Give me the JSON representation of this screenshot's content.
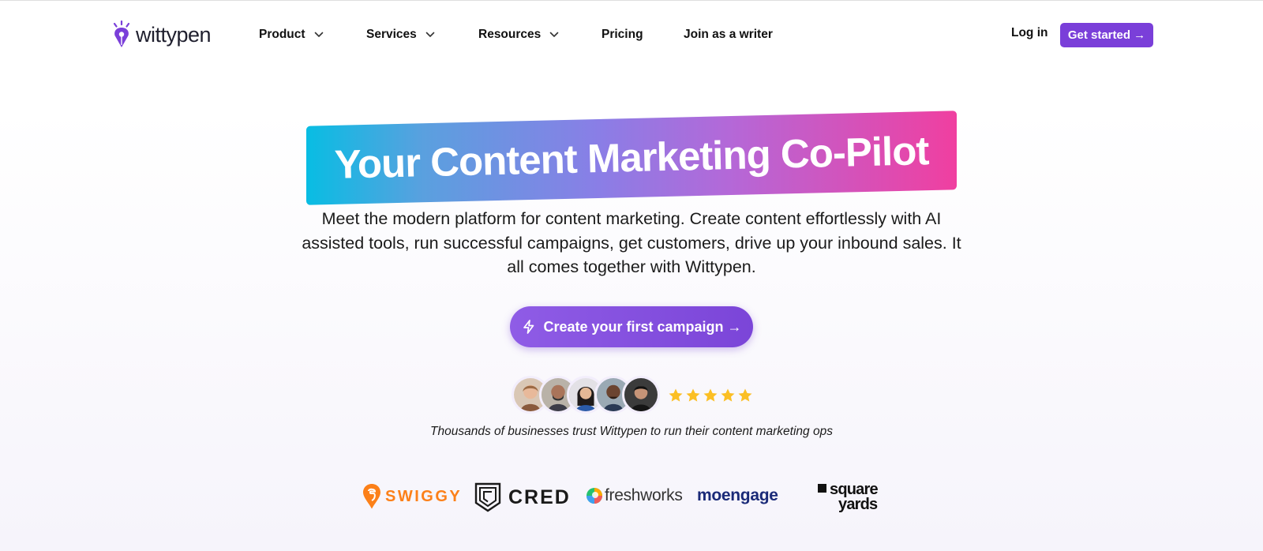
{
  "nav": {
    "logo_text": "wittypen",
    "items": [
      {
        "label": "Product",
        "has_dropdown": true
      },
      {
        "label": "Services",
        "has_dropdown": true
      },
      {
        "label": "Resources",
        "has_dropdown": true
      },
      {
        "label": "Pricing",
        "has_dropdown": false
      },
      {
        "label": "Join as a writer",
        "has_dropdown": false
      }
    ],
    "login_label": "Log in",
    "get_started_label": "Get started →"
  },
  "hero": {
    "headline": "Your Content Marketing Co-Pilot",
    "subtitle": "Meet the modern platform for content marketing. Create content effortlessly with AI assisted tools, run successful campaigns, get customers, drive up your inbound sales. It all comes together with Wittypen.",
    "cta_label": "Create your first campaign →",
    "cta_icon": "lightning-bolt-icon",
    "rating_stars": 5,
    "avatar_count": 5,
    "trust_text": "Thousands of businesses trust Wittypen to run their content marketing ops"
  },
  "clients": {
    "swiggy": "SWIGGY",
    "cred": "CRED",
    "freshworks": "freshworks",
    "moengage": "moengage",
    "squareyards_line1": "square",
    "squareyards_line2": "yards"
  },
  "colors": {
    "accent": "#7a3fd9",
    "star": "#fbbf24",
    "swiggy": "#fc8019",
    "moengage": "#1a2a78"
  }
}
